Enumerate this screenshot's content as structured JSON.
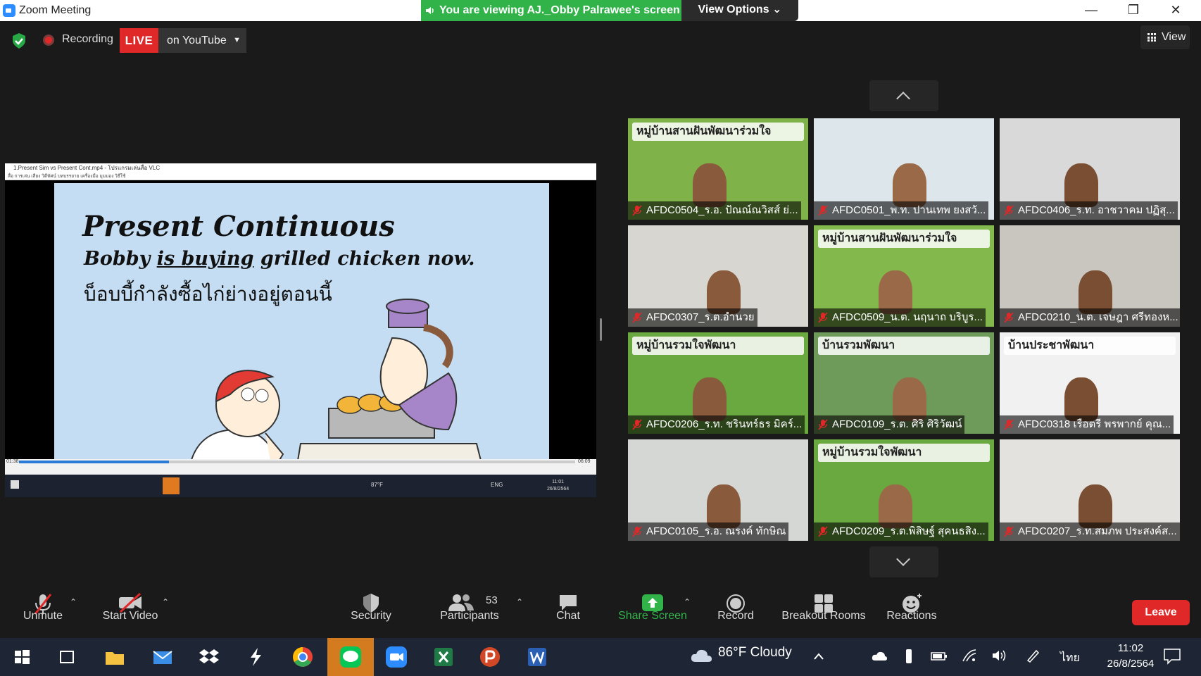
{
  "window": {
    "title": "Zoom Meeting"
  },
  "banner": {
    "text": "You are viewing AJ._Obby Palrawee's screen",
    "view_options": "View Options ⌄"
  },
  "window_controls": {
    "minimize": "—",
    "restore": "❐",
    "close": "✕"
  },
  "top": {
    "recording": "Recording",
    "live": "LIVE",
    "youtube": "on YouTube",
    "view": "View"
  },
  "shared": {
    "vlc_title": "1.Present Sim vs Present Cont.mp4 - โปรแกรมเล่นสื่อ VLC",
    "vlc_menu": "สื่อ   การเล่น   เสียง   วิดีทัศน์   บทบรรยาย   เครื่องมือ   มุมมอง   วิธีใช้",
    "slide_title": "Present Continuous",
    "slide_sentence_pre": "Bobby ",
    "slide_sentence_under": "is buying",
    "slide_sentence_post": " grilled chicken now.",
    "slide_thai": "บ็อบบี้กำลังซื้อไก่ย่างอยู่ตอนนี้",
    "time_elapsed": "01:38",
    "time_total": "06:09",
    "progress": 0.27,
    "inner_weather": "87°F",
    "inner_lang": "ENG",
    "inner_time": "11:01",
    "inner_date": "26/8/2564"
  },
  "participants": [
    {
      "name": "AFDC0504_ร.อ. ปัณณ์ณวิสส์ ย่...",
      "bg": "#7fb34a",
      "banner": "หมู่บ้านสานฝันพัฒนาร่วมใจ"
    },
    {
      "name": "AFDC0501_พ.ท. ปานเทพ ยงสวั...",
      "bg": "#dde6ea",
      "banner": ""
    },
    {
      "name": "AFDC0406_ร.ท. อาชวาคม ปฏิสุ...",
      "bg": "#d9d9d9",
      "banner": ""
    },
    {
      "name": "AFDC0307_ร.ต.อำนวย",
      "bg": "#d8d6d0",
      "banner": ""
    },
    {
      "name": "AFDC0509_น.ต. นฤนาถ บริบูร...",
      "bg": "#83b84c",
      "banner": "หมู่บ้านสานฝันพัฒนาร่วมใจ"
    },
    {
      "name": "AFDC0210_น.ต. เจษฎา ศรีทองห...",
      "bg": "#c9c6c0",
      "banner": ""
    },
    {
      "name": "AFDC0206_ร.ท. ชรินทร์ธร มิคร์...",
      "bg": "#6aa840",
      "banner": "หมู่บ้านรวมใจพัฒนา"
    },
    {
      "name": "AFDC0109_ร.ต. ศิริ ศิริวัฒน์",
      "bg": "#6e9a5a",
      "banner": "บ้านรวมพัฒนา"
    },
    {
      "name": "AFDC0318 เรือตรี พรพากย์ คุณ...",
      "bg": "#f1f1f1",
      "banner": "บ้านประชาพัฒนา"
    },
    {
      "name": "AFDC0105_ร.อ. ณรงค์ ทักษิณ",
      "bg": "#d5d7d4",
      "banner": ""
    },
    {
      "name": "AFDC0209_ร.ต.พิสิษฐ์ สุคนธสิง...",
      "bg": "#6aa840",
      "banner": "หมู่บ้านรวมใจพัฒนา"
    },
    {
      "name": "AFDC0207_ร.ท.สมภพ ประสงค์ส...",
      "bg": "#e4e2de",
      "banner": ""
    }
  ],
  "toolbar": {
    "unmute": "Unmute",
    "start_video": "Start Video",
    "security": "Security",
    "participants": "Participants",
    "participant_count": "53",
    "chat": "Chat",
    "share_screen": "Share Screen",
    "record": "Record",
    "breakout": "Breakout Rooms",
    "reactions": "Reactions",
    "leave": "Leave",
    "share_color": "#32b34a"
  },
  "taskbar": {
    "weather": "86°F  Cloudy",
    "lang": "ไทย",
    "time": "11:02",
    "date": "26/8/2564"
  }
}
